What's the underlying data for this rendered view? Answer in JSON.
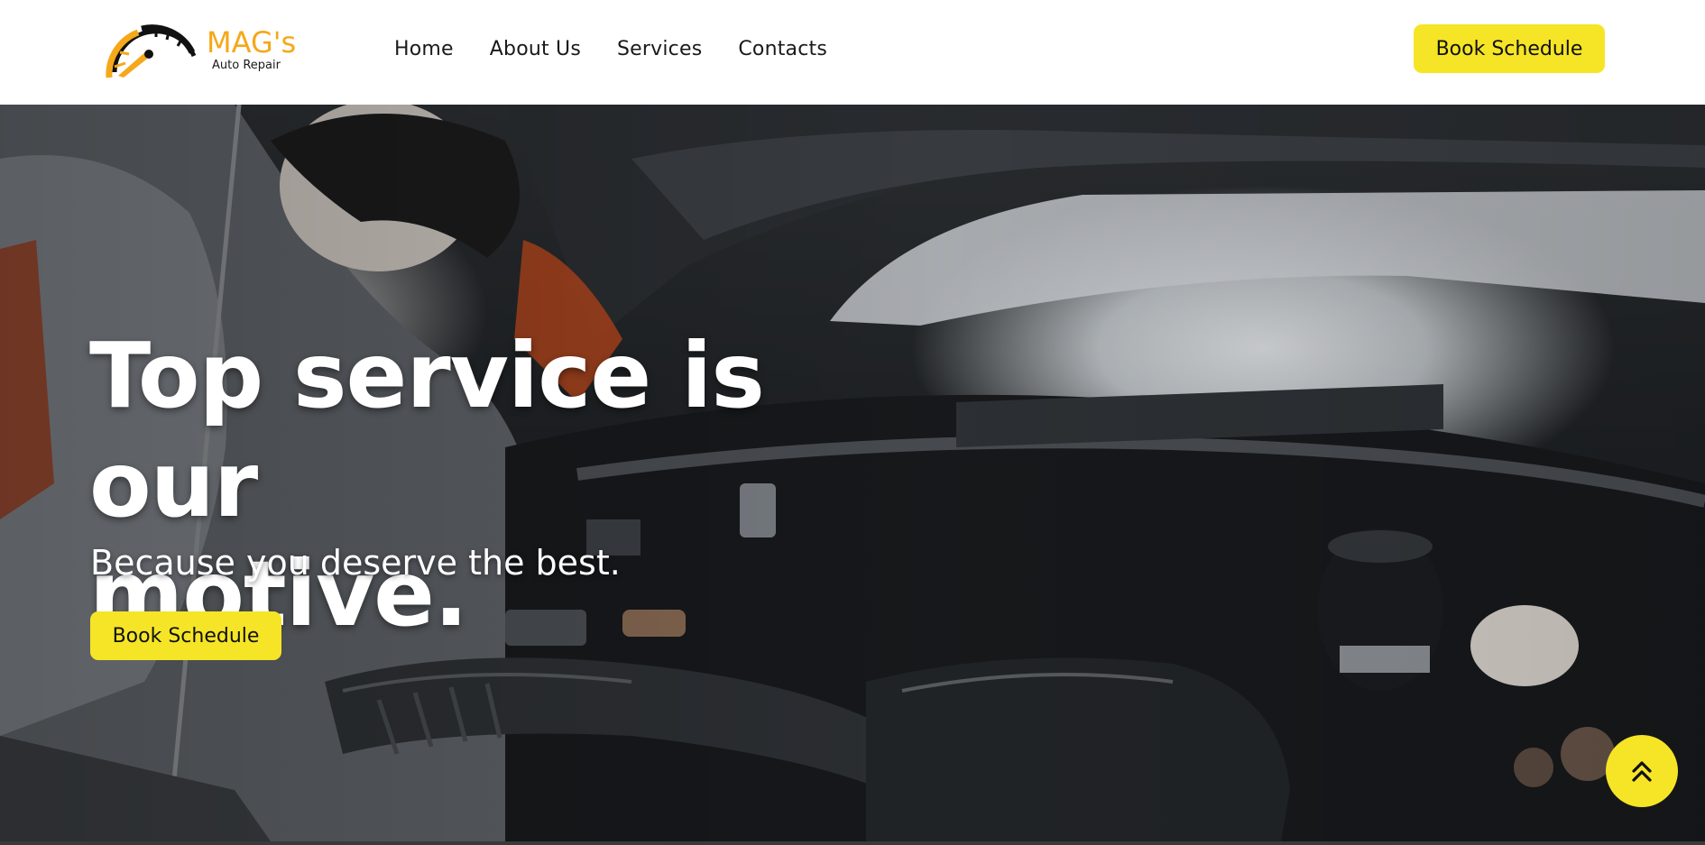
{
  "colors": {
    "accent": "#f5e526",
    "logo_orange": "#f5a81a",
    "text_dark": "#1a1a1a"
  },
  "logo": {
    "name": "MAG's",
    "subtitle": "Auto Repair",
    "icon": "speedometer-icon"
  },
  "nav": {
    "items": [
      {
        "label": "Home"
      },
      {
        "label": "About Us"
      },
      {
        "label": "Services"
      },
      {
        "label": "Contacts"
      }
    ]
  },
  "header": {
    "cta_label": "Book Schedule"
  },
  "hero": {
    "title_line1": "Top service is our",
    "title_line2": "motive.",
    "subtitle": "Because you deserve the best.",
    "cta_label": "Book Schedule",
    "background_image": "mechanic working on car engine bay"
  },
  "scroll_top": {
    "icon": "double-chevron-up-icon"
  }
}
